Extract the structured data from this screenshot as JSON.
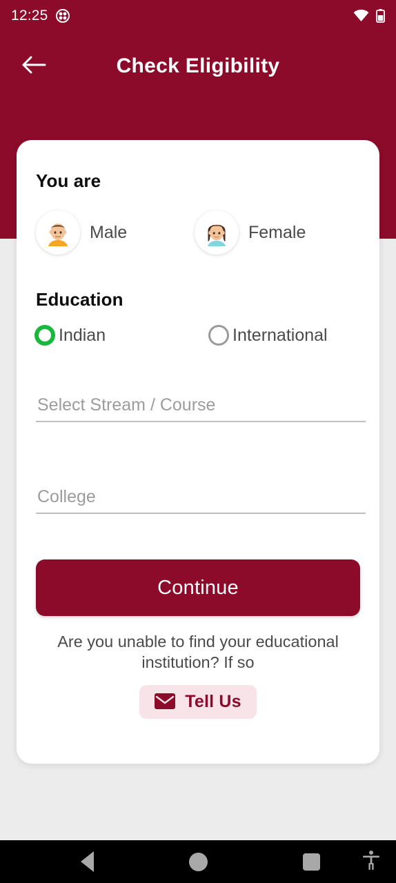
{
  "status_bar": {
    "time": "12:25",
    "left_icon": "app-badge-icon",
    "wifi_icon": "wifi-icon",
    "battery_icon": "battery-icon"
  },
  "app_bar": {
    "back_icon": "back-arrow-icon",
    "title": "Check Eligibility"
  },
  "card": {
    "you_are": {
      "heading": "You are",
      "options": [
        {
          "label": "Male",
          "icon": "male-avatar-icon",
          "selected": false
        },
        {
          "label": "Female",
          "icon": "female-avatar-icon",
          "selected": false
        }
      ]
    },
    "education": {
      "heading": "Education",
      "options": [
        {
          "label": "Indian",
          "selected": true
        },
        {
          "label": "International",
          "selected": false
        }
      ]
    },
    "fields": [
      {
        "name": "stream-course",
        "value": "",
        "placeholder": "Select Stream / Course"
      },
      {
        "name": "college",
        "value": "",
        "placeholder": "College"
      }
    ],
    "continue_label": "Continue",
    "helper_text": "Are you unable to find your educational institution? If so",
    "tell_us": {
      "label": "Tell Us",
      "icon": "envelope-icon"
    }
  },
  "nav_bar": {
    "back": "nav-back-icon",
    "home": "nav-home-icon",
    "recents": "nav-recents-icon",
    "accessibility": "accessibility-icon"
  },
  "colors": {
    "brand_maroon": "#8C0B2B",
    "page_background": "#ECECEC",
    "card_background": "#FFFFFF",
    "selected_radio_green": "#18B83C",
    "unselected_radio_gray": "#9A9A9A",
    "tell_us_background": "#F8E3E9",
    "nav_bar_background": "#000000"
  }
}
